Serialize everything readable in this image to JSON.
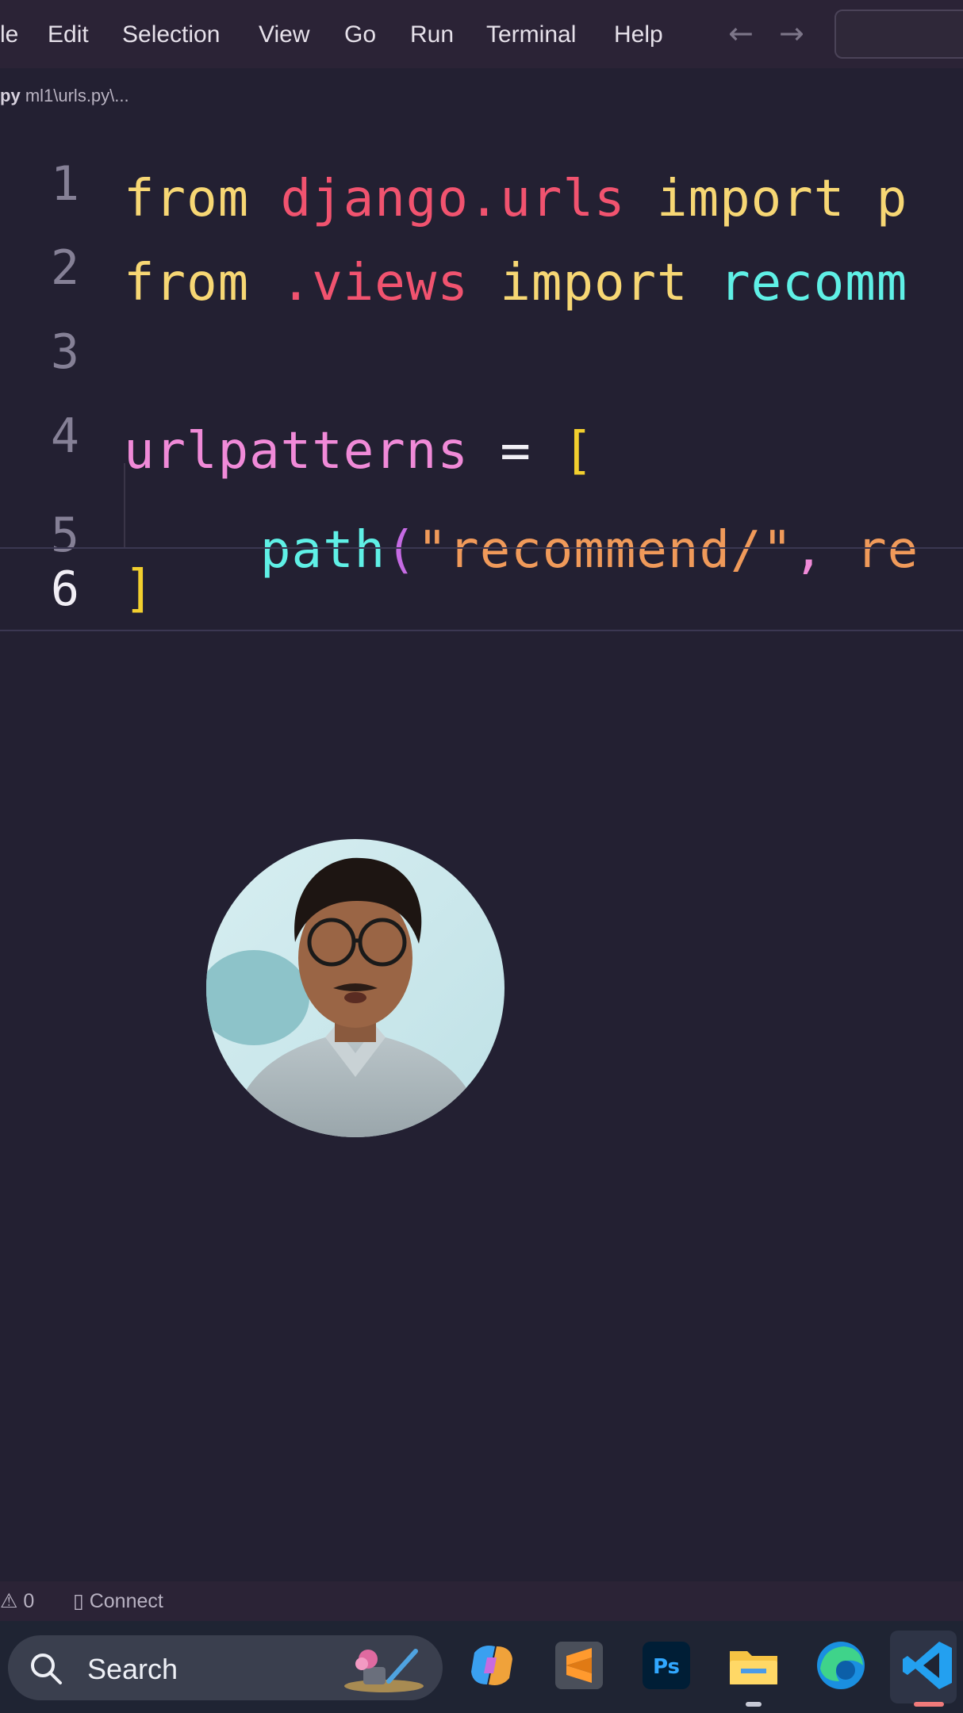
{
  "menubar": {
    "items": [
      "le",
      "Edit",
      "Selection",
      "View",
      "Go",
      "Run",
      "Terminal",
      "Help"
    ],
    "back_arrow": "←",
    "forward_arrow": "→"
  },
  "breadcrumb": {
    "file": "py",
    "path": "ml1\\urls.py\\..."
  },
  "editor": {
    "lines": [
      {
        "number": "1"
      },
      {
        "number": "2"
      },
      {
        "number": "3"
      },
      {
        "number": "4"
      },
      {
        "number": "5"
      },
      {
        "number": "6"
      }
    ],
    "tokens": {
      "l1_from": "from",
      "l1_module": "django",
      "l1_dot": ".",
      "l1_module2": "urls",
      "l1_import": "import",
      "l1_name": "p",
      "l2_from": "from",
      "l2_dot": ".",
      "l2_module": "views",
      "l2_import": "import",
      "l2_name": "recomm",
      "l4_var": "urlpatterns",
      "l4_eq": "=",
      "l4_bracket": "[",
      "l5_fn": "path",
      "l5_paren": "(",
      "l5_str": "\"recommend/\"",
      "l5_comma": ",",
      "l5_rest": "re",
      "l6_bracket": "]"
    }
  },
  "statusbar": {
    "problems_count": "0",
    "connect_label": "Connect"
  },
  "taskbar": {
    "search_label": "Search",
    "apps": [
      "copilot-icon",
      "sublime-text-icon",
      "photoshop-icon",
      "file-explorer-icon",
      "edge-icon",
      "vscode-icon"
    ]
  },
  "colors": {
    "editor_bg": "#232032",
    "keyword": "#f7d774",
    "module": "#f1536f",
    "function": "#5ff0e6",
    "variable": "#f08ad8",
    "string": "#f09a5a",
    "bracket": "#f2cf2e"
  }
}
